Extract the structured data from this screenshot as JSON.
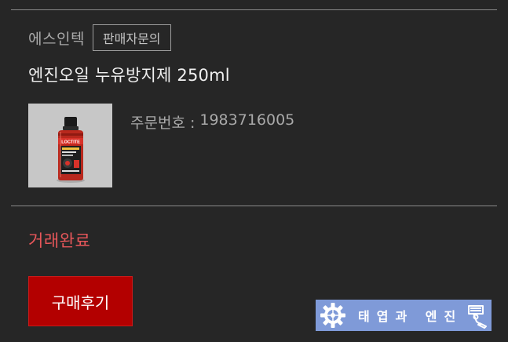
{
  "seller": {
    "name": "에스인텍",
    "inquiry_label": "판매자문의"
  },
  "product": {
    "title": "엔진오일 누유방지제 250ml",
    "thumbnail_icon": "product-bottle-image",
    "thumbnail_brand_text": "LOCTITE"
  },
  "order": {
    "label": "주문번호 :",
    "number": "1983716005"
  },
  "status": {
    "text": "거래완료",
    "color": "#e8575a"
  },
  "actions": {
    "review_label": "구매후기",
    "review_color": "#b30000"
  },
  "watermark": {
    "text": "태엽과 엔진",
    "left_icon": "gear-icon",
    "right_icon": "engine-piston-icon",
    "background": "#7f9ad8"
  }
}
